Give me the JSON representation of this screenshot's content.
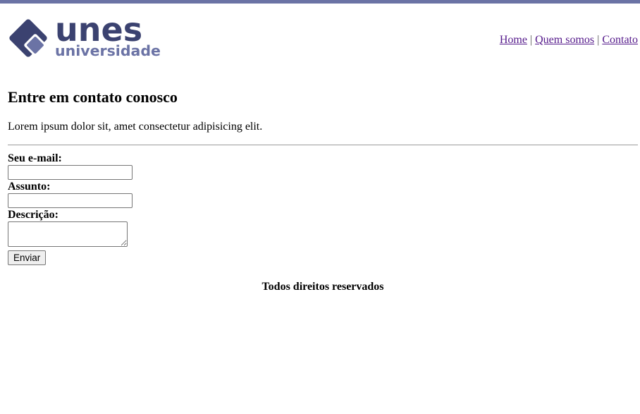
{
  "header": {
    "logo": {
      "main_text": "unes",
      "sub_text": "universidade"
    },
    "nav": {
      "items": [
        {
          "label": "Home"
        },
        {
          "label": "Quem somos"
        },
        {
          "label": "Contato"
        }
      ],
      "separator": "|"
    }
  },
  "main": {
    "title": "Entre em contato conosco",
    "intro": "Lorem ipsum dolor sit, amet consectetur adipisicing elit.",
    "form": {
      "email_label": "Seu e-mail:",
      "email_value": "",
      "subject_label": "Assunto:",
      "subject_value": "",
      "description_label": "Descrição:",
      "description_value": "",
      "submit_label": "Enviar"
    }
  },
  "footer": {
    "text": "Todos direitos reservados"
  },
  "colors": {
    "top_bar": "#6b73a5",
    "logo_dark": "#3b4270",
    "logo_light": "#6b73a5",
    "link": "#551a8b"
  }
}
